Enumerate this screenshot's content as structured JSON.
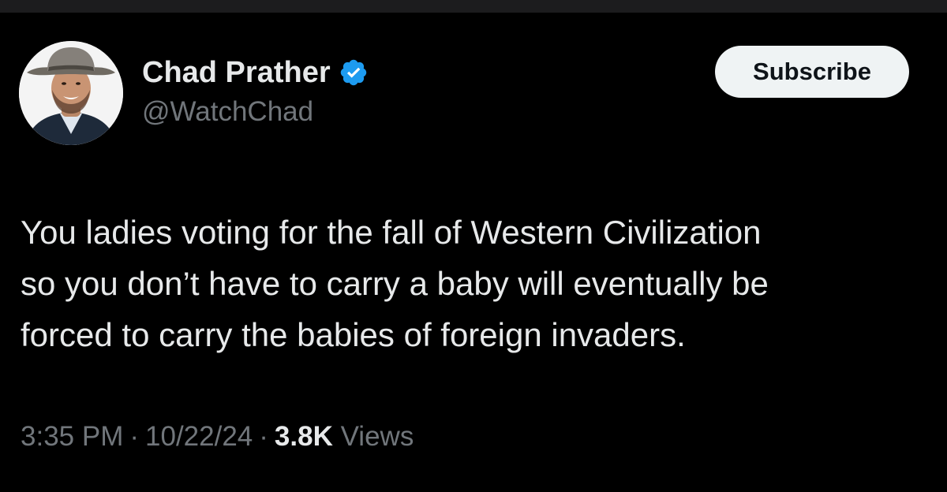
{
  "author": {
    "display_name": "Chad Prather",
    "handle": "@WatchChad",
    "verified_icon": "verified-badge-icon",
    "verified_color": "#1d9bf0"
  },
  "actions": {
    "subscribe_label": "Subscribe"
  },
  "tweet": {
    "text": "You ladies voting for the fall of Western Civilization\nso you don’t have to carry a baby will eventually be\nforced to carry the babies of foreign invaders."
  },
  "meta": {
    "time": "3:35 PM",
    "separator": "·",
    "date": "10/22/24",
    "views_count": "3.8K",
    "views_label": "Views"
  },
  "colors": {
    "background": "#000000",
    "text_primary": "#e7e9ea",
    "text_secondary": "#71767b",
    "button_bg": "#eff3f4"
  }
}
